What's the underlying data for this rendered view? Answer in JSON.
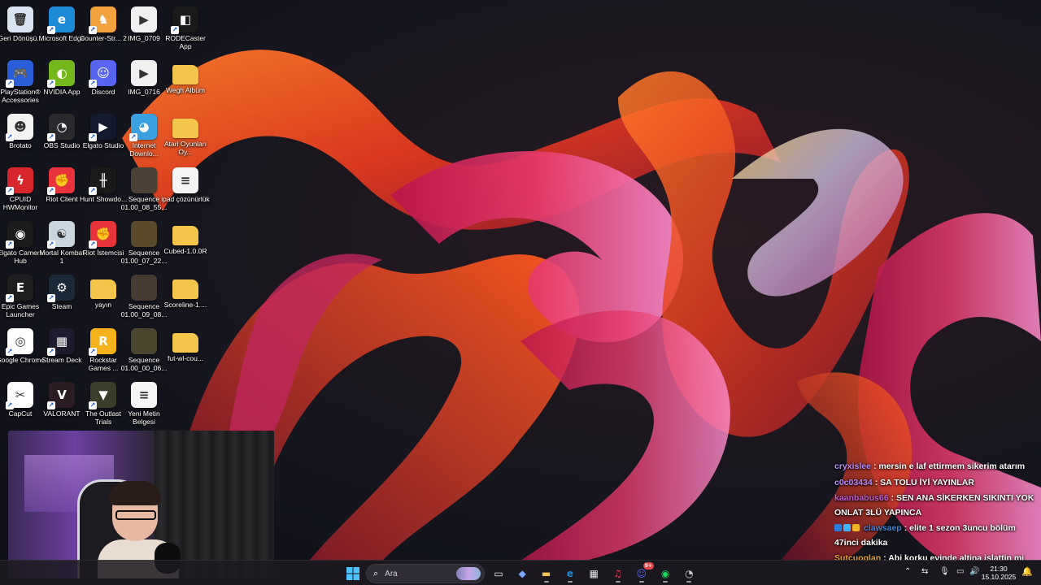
{
  "desktop": {
    "icons": [
      {
        "label": "Geri Dönüşü...",
        "icon": "recycle-bin-icon",
        "color": "#d7e4ef",
        "glyph": "🗑"
      },
      {
        "label": "PlayStation® Accessories",
        "icon": "playstation-icon",
        "color": "#2a5ed8",
        "glyph": "🎮"
      },
      {
        "label": "Brotato",
        "icon": "brotato-icon",
        "color": "#f3f3f3",
        "glyph": "☻"
      },
      {
        "label": "CPUID HWMonitor",
        "icon": "hwmonitor-icon",
        "color": "#d8262d",
        "glyph": "ϟ"
      },
      {
        "label": "Elgato Camera Hub",
        "icon": "elgato-camera-icon",
        "color": "#1b1b1b",
        "glyph": "◉"
      },
      {
        "label": "Epic Games Launcher",
        "icon": "epic-games-icon",
        "color": "#1e1e1e",
        "glyph": "E"
      },
      {
        "label": "Google Chrome",
        "icon": "chrome-icon",
        "color": "#ffffff",
        "glyph": "◎"
      },
      {
        "label": "CapCut",
        "icon": "capcut-icon",
        "color": "#ffffff",
        "glyph": "✂"
      },
      {
        "label": "Microsoft Edge",
        "icon": "edge-icon",
        "color": "#1d8ad6",
        "glyph": "e"
      },
      {
        "label": "NVIDIA App",
        "icon": "nvidia-icon",
        "color": "#74b71b",
        "glyph": "◐"
      },
      {
        "label": "OBS Studio",
        "icon": "obs-icon",
        "color": "#2a2a2e",
        "glyph": "◔"
      },
      {
        "label": "Riot Client",
        "icon": "riot-client-icon",
        "color": "#e8333c",
        "glyph": "✊"
      },
      {
        "label": "Mortal Kombat 1",
        "icon": "mortal-kombat-icon",
        "color": "#c9d6de",
        "glyph": "☯"
      },
      {
        "label": "Steam",
        "icon": "steam-icon",
        "color": "#1b2838",
        "glyph": "⚙"
      },
      {
        "label": "Stream Deck",
        "icon": "stream-deck-icon",
        "color": "#1c1c2e",
        "glyph": "▦"
      },
      {
        "label": "VALORANT",
        "icon": "valorant-icon",
        "color": "#2b1b22",
        "glyph": "V"
      },
      {
        "label": "Counter-Str... 2",
        "icon": "counter-strike-icon",
        "color": "#f1a23c",
        "glyph": "♞"
      },
      {
        "label": "Discord",
        "icon": "discord-icon",
        "color": "#5865f2",
        "glyph": "☺"
      },
      {
        "label": "Elgato Studio",
        "icon": "elgato-studio-icon",
        "color": "#141a2e",
        "glyph": "▶"
      },
      {
        "label": "Hunt Showdo...",
        "icon": "hunt-showdown-icon",
        "color": "#1a1a1a",
        "glyph": "╫"
      },
      {
        "label": "Riot İstemcisi",
        "icon": "riot-istemcisi-icon",
        "color": "#e8333c",
        "glyph": "✊"
      },
      {
        "label": "yayın",
        "icon": "folder-icon",
        "color": "#f3c54a",
        "glyph": ""
      },
      {
        "label": "Rockstar Games ...",
        "icon": "rockstar-icon",
        "color": "#f5b21a",
        "glyph": "R"
      },
      {
        "label": "The Outlast Trials",
        "icon": "outlast-icon",
        "color": "#3b3d2b",
        "glyph": "▼"
      },
      {
        "label": "IMG_0709",
        "icon": "video-file-icon",
        "color": "#f0f0f0",
        "glyph": "▶"
      },
      {
        "label": "IMG_0716",
        "icon": "video-file-icon",
        "color": "#f0f0f0",
        "glyph": "▶"
      },
      {
        "label": "Internet Downlo...",
        "icon": "idm-icon",
        "color": "#3aa0e0",
        "glyph": "◕"
      },
      {
        "label": "Sequence 01.00_08_55...",
        "icon": "image-thumb-icon",
        "color": "#4a4036",
        "glyph": ""
      },
      {
        "label": "Sequence 01.00_07_22...",
        "icon": "image-thumb-icon",
        "color": "#5a4a2c",
        "glyph": ""
      },
      {
        "label": "Sequence 01.00_09_08...",
        "icon": "image-thumb-icon",
        "color": "#463a32",
        "glyph": ""
      },
      {
        "label": "Sequence 01.00_00_06...",
        "icon": "image-thumb-icon",
        "color": "#4b4630",
        "glyph": ""
      },
      {
        "label": "Yeni Metin Belgesi",
        "icon": "text-file-icon",
        "color": "#f5f5f5",
        "glyph": "≡"
      },
      {
        "label": "RODECaster App",
        "icon": "rodecaster-icon",
        "color": "#1a1a1a",
        "glyph": "◧"
      },
      {
        "label": "Wegh Albüm",
        "icon": "folder-icon",
        "color": "#f3c54a",
        "glyph": ""
      },
      {
        "label": "Atari Oyunları Oy...",
        "icon": "folder-icon",
        "color": "#f3c54a",
        "glyph": ""
      },
      {
        "label": "ipad çözünürlük",
        "icon": "text-file-icon",
        "color": "#f5f5f5",
        "glyph": "≡"
      },
      {
        "label": "Cubed-1.0.0R",
        "icon": "folder-icon",
        "color": "#f3c54a",
        "glyph": ""
      },
      {
        "label": "Scoreline-1....",
        "icon": "folder-icon",
        "color": "#f3c54a",
        "glyph": ""
      },
      {
        "label": "fut-wl-cou...",
        "icon": "folder-icon",
        "color": "#f3c54a",
        "glyph": ""
      }
    ]
  },
  "chat": {
    "messages": [
      {
        "user": "cryxislee",
        "user_color": "#b58cff",
        "text": ": mersin e laf ettirmem sikerim atarım",
        "badges": []
      },
      {
        "user": "c0c03434",
        "user_color": "#b58cff",
        "text": ": SA TOLU İYİ YAYINLAR",
        "badges": []
      },
      {
        "user": "kaanbabus66",
        "user_color": "#c35bd6",
        "text": ": SEN ANA SİKERKEN SIKINTI YOK ONLAT 3LÜ YAPINCA",
        "badges": []
      },
      {
        "user": "clawsaep",
        "user_color": "#3b83e0",
        "text": ": elite 1 sezon 3uncu bölüm 47inci dakika",
        "badges": [
          "#2b7de0",
          "#3fb6ff",
          "#f0b429"
        ]
      },
      {
        "user": "Sutcuoglan",
        "user_color": "#e0a33a",
        "text": ": Abi korku evinde altina islattin mi",
        "badges": []
      }
    ]
  },
  "taskbar": {
    "search_placeholder": "Ara",
    "apps": [
      {
        "name": "task-view-icon",
        "glyph": "▭",
        "color": "#e8e8ee"
      },
      {
        "name": "copilot-icon",
        "glyph": "◆",
        "color": "#7aa7ff"
      },
      {
        "name": "file-explorer-icon",
        "glyph": "▬",
        "color": "#f3c54a"
      },
      {
        "name": "edge-icon",
        "glyph": "e",
        "color": "#1d8ad6"
      },
      {
        "name": "microsoft-store-icon",
        "glyph": "▦",
        "color": "#e8e8ee"
      },
      {
        "name": "apple-music-icon",
        "glyph": "♫",
        "color": "#fa3d55"
      },
      {
        "name": "discord-icon",
        "glyph": "☺",
        "color": "#5865f2"
      },
      {
        "name": "spotify-icon",
        "glyph": "◉",
        "color": "#1ed760"
      },
      {
        "name": "obs-icon",
        "glyph": "◔",
        "color": "#d0d0d6"
      }
    ],
    "tray": [
      {
        "name": "chevron-up-icon",
        "glyph": "⌃"
      },
      {
        "name": "network-share-icon",
        "glyph": "⇆"
      },
      {
        "name": "microphone-icon",
        "glyph": "🎙"
      },
      {
        "name": "display-icon",
        "glyph": "▭"
      },
      {
        "name": "volume-icon",
        "glyph": "🔊"
      }
    ],
    "time": "21:30",
    "date": "15.10.2025",
    "discord_badge": "9+"
  }
}
